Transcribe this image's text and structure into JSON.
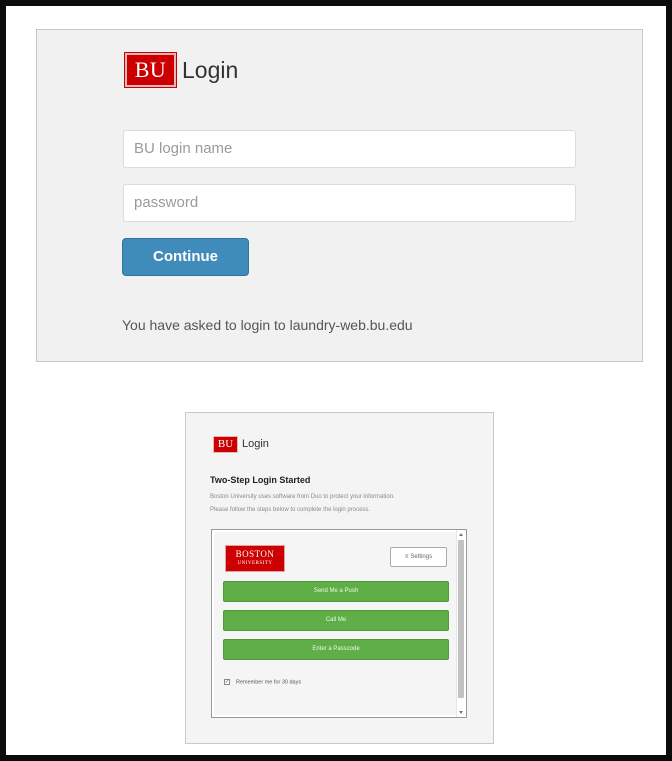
{
  "login": {
    "logo": "BU",
    "title": "Login",
    "username_placeholder": "BU login name",
    "password_placeholder": "password",
    "continue_label": "Continue",
    "info_text": "You have asked to login to laundry-web.bu.edu"
  },
  "duo": {
    "logo": "BU",
    "title": "Login",
    "heading": "Two-Step Login Started",
    "desc_line1": "Boston University uses software from Duo to protect your information.",
    "desc_line2": "Please follow the steps below to complete the login process.",
    "university_logo_line1": "BOSTON",
    "university_logo_line2": "UNIVERSITY",
    "settings_label": "Settings",
    "buttons": {
      "push": "Send Me a Push",
      "call": "Call Me",
      "passcode": "Enter a Passcode"
    },
    "remember_label": "Remember me for 30 days",
    "remember_checked": true
  },
  "colors": {
    "bu_red": "#cc0000",
    "continue_blue": "#3f8bb9",
    "duo_green": "#5fae48"
  },
  "icons": {
    "settings": "gear-icon",
    "checkbox": "checkbox-icon"
  }
}
